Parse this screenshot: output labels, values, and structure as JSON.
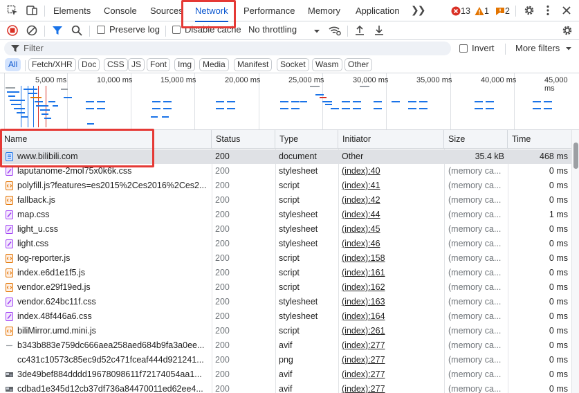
{
  "tabs": [
    {
      "label": "Elements"
    },
    {
      "label": "Console"
    },
    {
      "label": "Sources"
    },
    {
      "label": "Network",
      "active": true
    },
    {
      "label": "Performance"
    },
    {
      "label": "Memory"
    },
    {
      "label": "Application"
    }
  ],
  "counters": {
    "errors": "13",
    "warnings": "1",
    "issues": "2"
  },
  "toolbar": {
    "preserve_log": "Preserve log",
    "disable_cache": "Disable cache",
    "throttling": "No throttling"
  },
  "filter": {
    "placeholder": "Filter",
    "invert": "Invert",
    "more_filters": "More filters"
  },
  "type_filters": [
    "All",
    "Fetch/XHR",
    "Doc",
    "CSS",
    "JS",
    "Font",
    "Img",
    "Media",
    "Manifest",
    "Socket",
    "Wasm",
    "Other"
  ],
  "timeline_ticks": [
    "5,000 ms",
    "10,000 ms",
    "15,000 ms",
    "20,000 ms",
    "25,000 ms",
    "30,000 ms",
    "35,000 ms",
    "40,000 ms",
    "45,000 ms"
  ],
  "columns": {
    "name": "Name",
    "status": "Status",
    "type": "Type",
    "initiator": "Initiator",
    "size": "Size",
    "time": "Time"
  },
  "rows": [
    {
      "name": "www.bilibili.com",
      "status": "200",
      "type": "document",
      "initiator": "Other",
      "size": "35.4 kB",
      "time": "468 ms",
      "icon": "document"
    },
    {
      "name": "laputanome-2mol75x0k6k.css",
      "status": "200",
      "type": "stylesheet",
      "initiator": "(index):40",
      "size": "(memory ca...",
      "time": "0 ms",
      "icon": "stylesheet"
    },
    {
      "name": "polyfill.js?features=es2015%2Ces2016%2Ces2...",
      "status": "200",
      "type": "script",
      "initiator": "(index):41",
      "size": "(memory ca...",
      "time": "0 ms",
      "icon": "script"
    },
    {
      "name": "fallback.js",
      "status": "200",
      "type": "script",
      "initiator": "(index):42",
      "size": "(memory ca...",
      "time": "0 ms",
      "icon": "script"
    },
    {
      "name": "map.css",
      "status": "200",
      "type": "stylesheet",
      "initiator": "(index):44",
      "size": "(memory ca...",
      "time": "1 ms",
      "icon": "stylesheet"
    },
    {
      "name": "light_u.css",
      "status": "200",
      "type": "stylesheet",
      "initiator": "(index):45",
      "size": "(memory ca...",
      "time": "0 ms",
      "icon": "stylesheet"
    },
    {
      "name": "light.css",
      "status": "200",
      "type": "stylesheet",
      "initiator": "(index):46",
      "size": "(memory ca...",
      "time": "0 ms",
      "icon": "stylesheet"
    },
    {
      "name": "log-reporter.js",
      "status": "200",
      "type": "script",
      "initiator": "(index):158",
      "size": "(memory ca...",
      "time": "0 ms",
      "icon": "script"
    },
    {
      "name": "index.e6d1e1f5.js",
      "status": "200",
      "type": "script",
      "initiator": "(index):161",
      "size": "(memory ca...",
      "time": "0 ms",
      "icon": "script"
    },
    {
      "name": "vendor.e29f19ed.js",
      "status": "200",
      "type": "script",
      "initiator": "(index):162",
      "size": "(memory ca...",
      "time": "0 ms",
      "icon": "script"
    },
    {
      "name": "vendor.624bc11f.css",
      "status": "200",
      "type": "stylesheet",
      "initiator": "(index):163",
      "size": "(memory ca...",
      "time": "0 ms",
      "icon": "stylesheet"
    },
    {
      "name": "index.48f446a6.css",
      "status": "200",
      "type": "stylesheet",
      "initiator": "(index):164",
      "size": "(memory ca...",
      "time": "0 ms",
      "icon": "stylesheet"
    },
    {
      "name": "biliMirror.umd.mini.js",
      "status": "200",
      "type": "script",
      "initiator": "(index):261",
      "size": "(memory ca...",
      "time": "0 ms",
      "icon": "script"
    },
    {
      "name": "b343b883e759dc666aea258aed684b9fa3a0ee...",
      "status": "200",
      "type": "avif",
      "initiator": "(index):277",
      "size": "(memory ca...",
      "time": "0 ms",
      "icon": "image-dash"
    },
    {
      "name": "cc431c10573c85ec9d52c471fceaf444d921241...",
      "status": "200",
      "type": "png",
      "initiator": "(index):277",
      "size": "(memory ca...",
      "time": "0 ms",
      "icon": "image-blank"
    },
    {
      "name": "3de49bef884dddd19678098611f72174054aa1...",
      "status": "200",
      "type": "avif",
      "initiator": "(index):277",
      "size": "(memory ca...",
      "time": "0 ms",
      "icon": "image-thumb"
    },
    {
      "name": "cdbad1e345d12cb37df736a84470011ed62ee4...",
      "status": "200",
      "type": "avif",
      "initiator": "(index):277",
      "size": "(memory ca...",
      "time": "0 ms",
      "icon": "image-thumb"
    }
  ],
  "colors": {
    "accent": "#0b57d0",
    "highlight": "#e53935",
    "error": "#d93025",
    "warning": "#e37400"
  }
}
